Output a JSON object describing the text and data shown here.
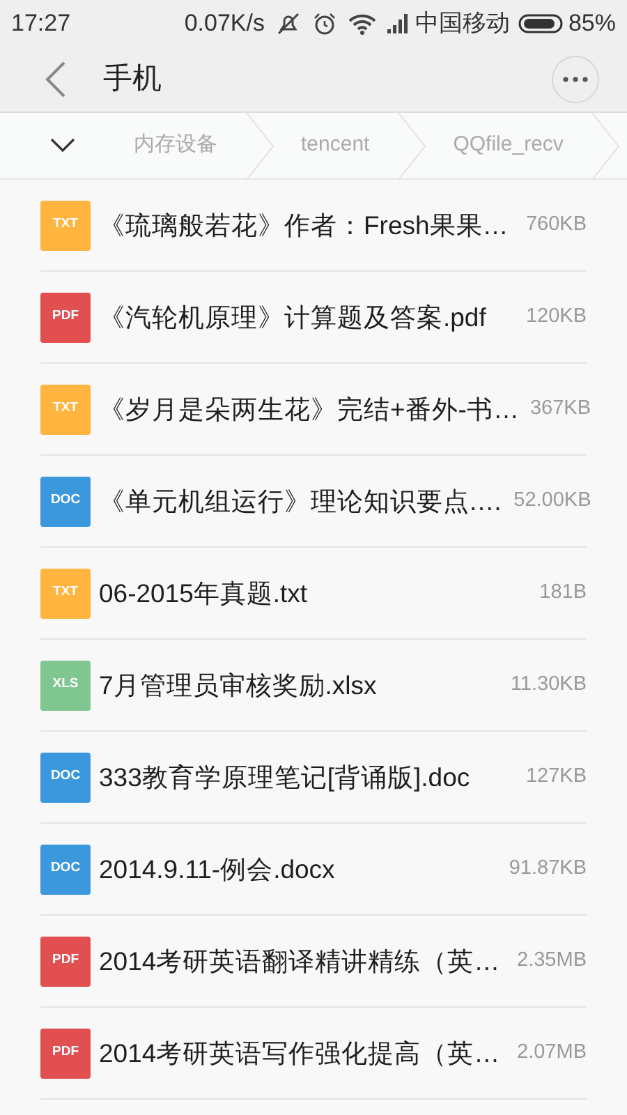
{
  "status_bar": {
    "time": "17:27",
    "speed": "0.07K/s",
    "carrier": "中国移动",
    "battery": "85%"
  },
  "header": {
    "title": "手机"
  },
  "breadcrumb": [
    "内存设备",
    "tencent",
    "QQfile_recv"
  ],
  "files": [
    {
      "color": "#ffb53f",
      "badge": "TXT",
      "name": "《琉璃般若花》作者：Fresh果果…",
      "size": "760KB"
    },
    {
      "color": "#e24f51",
      "badge": "PDF",
      "name": "《汽轮机原理》计算题及答案.pdf",
      "size": "120KB"
    },
    {
      "color": "#ffb53f",
      "badge": "TXT",
      "name": "《岁月是朵两生花》完结+番外-书…",
      "size": "367KB"
    },
    {
      "color": "#3c98dd",
      "badge": "DOC",
      "name": "《单元机组运行》理论知识要点.…",
      "size": "52.00KB"
    },
    {
      "color": "#ffb53f",
      "badge": "TXT",
      "name": "06-2015年真题.txt",
      "size": "181B"
    },
    {
      "color": "#80c690",
      "badge": "XLS",
      "name": "7月管理员审核奖励.xlsx",
      "size": "11.30KB"
    },
    {
      "color": "#3c98dd",
      "badge": "DOC",
      "name": "333教育学原理笔记[背诵版].doc",
      "size": "127KB"
    },
    {
      "color": "#3c98dd",
      "badge": "DOC",
      "name": "2014.9.11-例会.docx",
      "size": "91.87KB"
    },
    {
      "color": "#e24f51",
      "badge": "PDF",
      "name": "2014考研英语翻译精讲精练（英…",
      "size": "2.35MB"
    },
    {
      "color": "#e24f51",
      "badge": "PDF",
      "name": "2014考研英语写作强化提高（英…",
      "size": "2.07MB"
    }
  ]
}
